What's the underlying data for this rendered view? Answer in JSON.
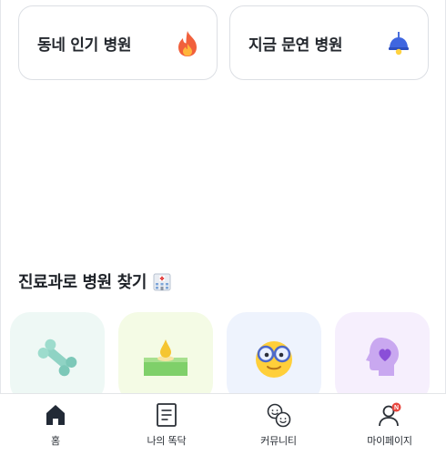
{
  "quick_links": [
    {
      "label": "동네 인기 병원",
      "icon": "fire-icon"
    },
    {
      "label": "지금 문연 병원",
      "icon": "lamp-icon"
    }
  ],
  "departments_section": {
    "title": "진료과로 병원 찾기",
    "icon": "hospital-icon"
  },
  "departments": [
    {
      "icon": "bone-icon",
      "color": "#eef8f5"
    },
    {
      "icon": "skin-droplet-icon",
      "color": "#f4fbe5"
    },
    {
      "icon": "eye-glasses-face-icon",
      "color": "#eef3fd"
    },
    {
      "icon": "mind-head-icon",
      "color": "#f6effd"
    }
  ],
  "tabbar": {
    "items": [
      {
        "label": "홈",
        "icon": "home-icon",
        "active": true
      },
      {
        "label": "나의 똑닥",
        "icon": "document-icon"
      },
      {
        "label": "커뮤니티",
        "icon": "community-icon"
      },
      {
        "label": "마이페이지",
        "icon": "user-icon",
        "badge": "N"
      }
    ]
  },
  "colors": {
    "badge": "#e8473f",
    "text": "#222831",
    "border": "#dcdfe4"
  }
}
